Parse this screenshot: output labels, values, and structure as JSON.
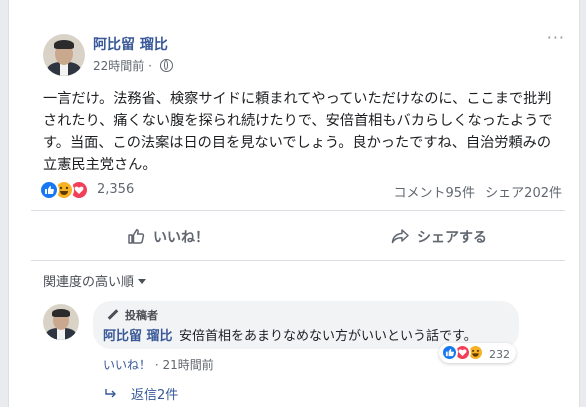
{
  "post": {
    "author": "阿比留 瑠比",
    "time": "22時間前",
    "dot": "·",
    "more_label": "···",
    "text": "一言だけ。法務省、検察サイドに頼まれてやっていただけなのに、ここまで批判されたり、痛くない腹を探られ続けたりで、安倍首相もバカらしくなったようです。当面、この法案は日の目を見ないでしょう。良かったですね、自治労頼みの立憲民主党さん。",
    "reaction_icons": [
      "like-icon",
      "haha-icon",
      "love-icon"
    ],
    "reaction_count": "2,356",
    "comments_count": "コメント95件",
    "shares_count": "シェア202件"
  },
  "actions": {
    "like": "いいね！",
    "share": "シェアする"
  },
  "comments_section": {
    "sort_label": "関連度の高い順"
  },
  "comment": {
    "badge": "投稿者",
    "author": "阿比留 瑠比",
    "text": "安倍首相をあまりなめない方がいいという話です。",
    "reaction_icons": [
      "like-icon",
      "love-icon",
      "haha-icon"
    ],
    "reaction_count": "232",
    "like_link": "いいね！",
    "time": "· 21時間前",
    "replies": "返信2件"
  },
  "colors": {
    "link_blue": "#385898",
    "like_blue": "#1877f2",
    "love_red": "#f33e58",
    "haha_yellow": "#f7b125",
    "background": "#e9ebee"
  }
}
